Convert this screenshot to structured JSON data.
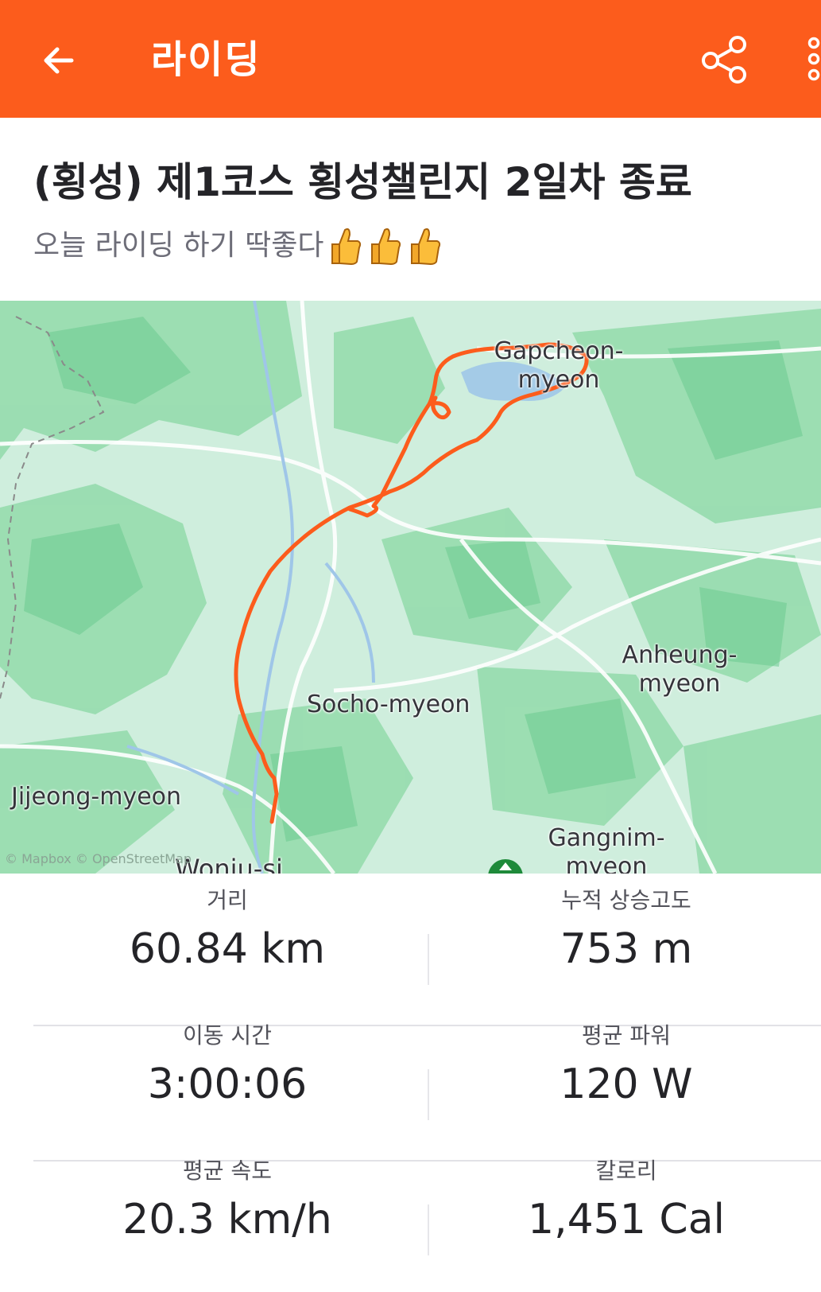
{
  "header": {
    "title": "라이딩",
    "back_icon": "arrow-left-icon",
    "share_icon": "share-icon",
    "more_icon": "more-vertical-icon",
    "background_color": "#fc5c1c"
  },
  "activity": {
    "title": "(횡성) 제1코스  횡성챌린지 2일차 종료",
    "description": "오늘 라이딩 하기 딱좋다",
    "description_emoji": "thumbs-up-icon",
    "emoji_count": 3
  },
  "map": {
    "labels": {
      "gapcheon": "Gapcheon-\nmyeon",
      "anheung": "Anheung-\nmyeon",
      "socho": "Socho-myeon",
      "jijeong": "Jijeong-myeon",
      "gangnim": "Gangnim-\nmyeon",
      "wonju": "Wonju-si"
    },
    "attribution": "© Mapbox © OpenStreetMap",
    "route_color": "#fc5c1c"
  },
  "stats": {
    "distance": {
      "label": "거리",
      "value": "60.84 km"
    },
    "elevation": {
      "label": "누적 상승고도",
      "value": "753 m"
    },
    "moving_time": {
      "label": "이동 시간",
      "value": "3:00:06"
    },
    "avg_power": {
      "label": "평균 파워",
      "value": "120 W"
    },
    "avg_speed": {
      "label": "평균 속도",
      "value": "20.3 km/h"
    },
    "calories": {
      "label": "칼로리",
      "value": "1,451 Cal"
    }
  }
}
